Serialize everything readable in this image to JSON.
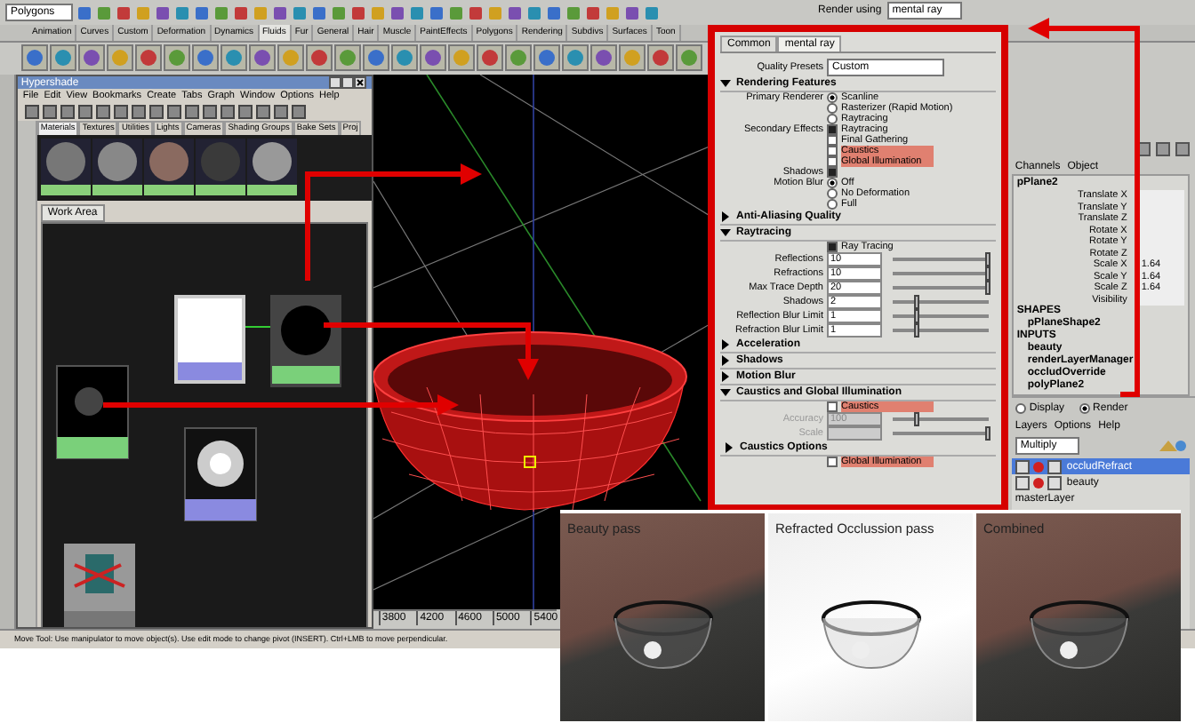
{
  "toolbar": {
    "mode_menu": "Polygons"
  },
  "shelf_tabs": [
    {
      "label": "Animation",
      "selected": false
    },
    {
      "label": "Curves",
      "selected": false
    },
    {
      "label": "Custom",
      "selected": false
    },
    {
      "label": "Deformation",
      "selected": false
    },
    {
      "label": "Dynamics",
      "selected": false
    },
    {
      "label": "Fluids",
      "selected": true
    },
    {
      "label": "Fur",
      "selected": false
    },
    {
      "label": "General",
      "selected": false
    },
    {
      "label": "Hair",
      "selected": false
    },
    {
      "label": "Muscle",
      "selected": false
    },
    {
      "label": "PaintEffects",
      "selected": false
    },
    {
      "label": "Polygons",
      "selected": false
    },
    {
      "label": "Rendering",
      "selected": false
    },
    {
      "label": "Subdivs",
      "selected": false
    },
    {
      "label": "Surfaces",
      "selected": false
    },
    {
      "label": "Toon",
      "selected": false
    }
  ],
  "hypershade": {
    "title": "Hypershade",
    "menu": [
      "File",
      "Edit",
      "View",
      "Bookmarks",
      "Create",
      "Tabs",
      "Graph",
      "Window",
      "Options",
      "Help"
    ],
    "tabs": [
      {
        "label": "Materials",
        "selected": true
      },
      {
        "label": "Textures",
        "selected": false
      },
      {
        "label": "Utilities",
        "selected": false
      },
      {
        "label": "Lights",
        "selected": false
      },
      {
        "label": "Cameras",
        "selected": false
      },
      {
        "label": "Shading Groups",
        "selected": false
      },
      {
        "label": "Bake Sets",
        "selected": false
      },
      {
        "label": "Proj",
        "selected": false
      }
    ],
    "work_area_tab": "Work Area"
  },
  "viewport": {
    "timeline_ticks": [
      "3800",
      "4200",
      "4600",
      "5000",
      "5400"
    ]
  },
  "render_settings": {
    "render_using_label": "Render using",
    "render_using": "mental ray",
    "tabs": [
      {
        "label": "Common",
        "selected": false
      },
      {
        "label": "mental ray",
        "selected": true
      }
    ],
    "quality_presets_label": "Quality Presets",
    "quality_presets": "Custom",
    "sections": [
      {
        "title": "Rendering Features",
        "expanded": true,
        "rows": [
          {
            "kind": "radio",
            "label": "Primary Renderer",
            "options": [
              {
                "text": "Scanline",
                "selected": true
              },
              {
                "text": "Rasterizer (Rapid Motion)",
                "selected": false
              },
              {
                "text": "Raytracing",
                "selected": false
              }
            ]
          },
          {
            "kind": "checks",
            "label": "Secondary Effects",
            "options": [
              {
                "text": "Raytracing",
                "checked": true,
                "highlighted": false
              },
              {
                "text": "Final Gathering",
                "checked": false,
                "highlighted": false
              },
              {
                "text": "Caustics",
                "checked": false,
                "highlighted": true
              },
              {
                "text": "Global Illumination",
                "checked": false,
                "highlighted": true
              }
            ]
          },
          {
            "kind": "checks",
            "label": "Shadows",
            "options": [
              {
                "checked": true
              }
            ]
          },
          {
            "kind": "radio",
            "label": "Motion Blur",
            "options": [
              {
                "text": "Off",
                "selected": true
              },
              {
                "text": "No Deformation",
                "selected": false
              },
              {
                "text": "Full",
                "selected": false
              }
            ]
          }
        ]
      },
      {
        "title": "Anti-Aliasing Quality",
        "expanded": false
      },
      {
        "title": "Raytracing",
        "expanded": true,
        "rows": [
          {
            "kind": "checks",
            "options": [
              {
                "text": "Ray Tracing",
                "checked": true,
                "highlighted": false
              }
            ]
          },
          {
            "kind": "field",
            "label": "Reflections",
            "value": "10",
            "level": 1
          },
          {
            "kind": "field",
            "label": "Refractions",
            "value": "10",
            "level": 1
          },
          {
            "kind": "field",
            "label": "Max Trace Depth",
            "value": "20",
            "level": 1
          },
          {
            "kind": "field",
            "label": "Shadows",
            "value": "2",
            "level": 0.25
          },
          {
            "kind": "field",
            "label": "Reflection Blur Limit",
            "value": "1",
            "level": 0.25
          },
          {
            "kind": "field",
            "label": "Refraction Blur Limit",
            "value": "1",
            "level": 0.25
          }
        ]
      },
      {
        "title": "Acceleration",
        "expanded": false
      },
      {
        "title": "Shadows",
        "expanded": false
      },
      {
        "title": "Motion Blur",
        "expanded": false
      },
      {
        "title": "Caustics and Global Illumination",
        "expanded": true,
        "rows": [
          {
            "kind": "checks",
            "options": [
              {
                "text": "Caustics",
                "checked": false,
                "highlighted": true
              }
            ]
          },
          {
            "kind": "field",
            "label": "Accuracy",
            "value": "100",
            "level": 0.25,
            "disabled": true
          },
          {
            "kind": "field",
            "label": "Scale",
            "level": 1,
            "disabled": true
          },
          {
            "kind": "subsection",
            "title": "Caustics Options",
            "expanded": false
          },
          {
            "kind": "checks",
            "options": [
              {
                "text": "Global Illumination",
                "checked": false,
                "highlighted": true
              }
            ]
          }
        ]
      }
    ]
  },
  "channel_box": {
    "tabs": [
      "Channels",
      "Object"
    ],
    "object": "pPlane2",
    "attributes": [
      {
        "name": "Translate X"
      },
      {
        "name": "Translate Y"
      },
      {
        "name": "Translate Z"
      },
      {
        "name": "Rotate X"
      },
      {
        "name": "Rotate Y"
      },
      {
        "name": "Rotate Z"
      },
      {
        "name": "Scale X",
        "value": "1.64"
      },
      {
        "name": "Scale Y",
        "value": "1.64"
      },
      {
        "name": "Scale Z",
        "value": "1.64"
      },
      {
        "name": "Visibility"
      }
    ],
    "shapes_heading": "SHAPES",
    "shape": "pPlaneShape2",
    "inputs_heading": "INPUTS",
    "inputs": [
      "beauty",
      "renderLayerManager",
      "occludOverride",
      "polyPlane2"
    ]
  },
  "layer_editor": {
    "modes": [
      {
        "label": "Display",
        "selected": false
      },
      {
        "label": "Render",
        "selected": true
      }
    ],
    "menu": [
      "Layers",
      "Options",
      "Help"
    ],
    "blend_mode": "Multiply",
    "layers": [
      {
        "kind": "layer",
        "name": "occludRefract",
        "selected": true
      },
      {
        "kind": "layer",
        "name": "beauty",
        "selected": false
      },
      {
        "kind": "master",
        "name": "masterLayer",
        "selected": false
      }
    ]
  },
  "passes": [
    {
      "caption": "Beauty pass",
      "kind": "dark"
    },
    {
      "caption": "Refracted Occlussion pass",
      "kind": "light"
    },
    {
      "caption": "Combined",
      "kind": "dark"
    }
  ],
  "status_line": "Move Tool: Use manipulator to move object(s). Use edit mode to change pivot (INSERT). Ctrl+LMB to move perpendicular."
}
